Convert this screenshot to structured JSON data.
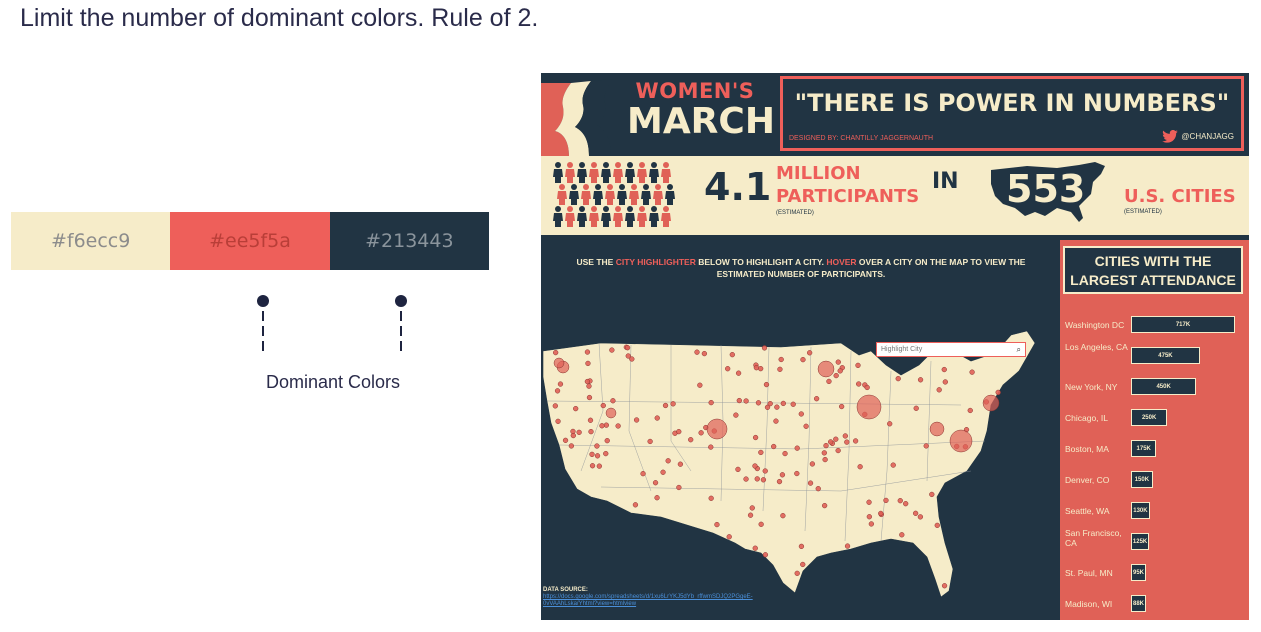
{
  "slide": {
    "title": "Limit the number of dominant colors. Rule of 2.",
    "dominant_label": "Dominant Colors",
    "swatches": [
      {
        "hex": "#f6ecc9",
        "label": "#f6ecc9",
        "text_color": "#8c8c8c"
      },
      {
        "hex": "#ee5f5a",
        "label": "#ee5f5a",
        "text_color": "#b93e38"
      },
      {
        "hex": "#213443",
        "label": "#213443",
        "text_color": "#8a949c"
      }
    ]
  },
  "viz": {
    "logo_top": "WOMEN'S",
    "logo_bottom": "MARCH",
    "quote": "\"THERE IS POWER IN NUMBERS\"",
    "designed_by": "DESIGNED BY: CHANTILLY JAGGERNAUTH",
    "handle": "@CHANJAGG",
    "participants_num": "4.1",
    "participants_label_1": "MILLION",
    "participants_label_2": "PARTICIPANTS",
    "estimated_1": "(ESTIMATED)",
    "in_word": "IN",
    "cities_num": "553",
    "cities_label": "U.S. CITIES",
    "estimated_2": "(ESTIMATED)",
    "instruction_1": "USE THE ",
    "instruction_hl_1": "CITY HIGHLIGHTER",
    "instruction_2": " BELOW TO HIGHLIGHT A CITY. ",
    "instruction_hl_2": "HOVER",
    "instruction_3": " OVER A CITY ON THE MAP TO VIEW THE ESTIMATED NUMBER OF PARTICIPANTS.",
    "highlight_placeholder": "Highlight City",
    "panel_title_1": "CITIES WITH THE",
    "panel_title_2": "LARGEST ATTENDANCE",
    "data_source_label": "DATA SOURCE:",
    "data_source_url": "https://docs.google.com/spreadsheets/d/1xu6LrYKJ5dYb_rffwmSDJQ2PGgeE-0vVAAhLska/Yhtml?view=htmlview",
    "colors": {
      "cream": "#f6ecc9",
      "coral": "#ee5f5a",
      "navy": "#213443"
    },
    "icons": [
      "twitter-icon",
      "search-icon",
      "women-silhouette-icon",
      "person-icon",
      "us-map-icon"
    ]
  },
  "chart_data": {
    "type": "bar",
    "title": "CITIES WITH THE LARGEST ATTENDANCE",
    "categories": [
      "Washington DC",
      "Los Angeles, CA",
      "New York, NY",
      "Chicago, IL",
      "Boston, MA",
      "Denver, CO",
      "Seattle, WA",
      "San Francisco, CA",
      "St. Paul, MN",
      "Madison, WI"
    ],
    "labels": [
      "717K",
      "475K",
      "450K",
      "250K",
      "175K",
      "150K",
      "130K",
      "125K",
      "95K",
      "88K"
    ],
    "values": [
      717,
      475,
      450,
      250,
      175,
      150,
      130,
      125,
      95,
      88
    ],
    "orientation": "horizontal"
  }
}
